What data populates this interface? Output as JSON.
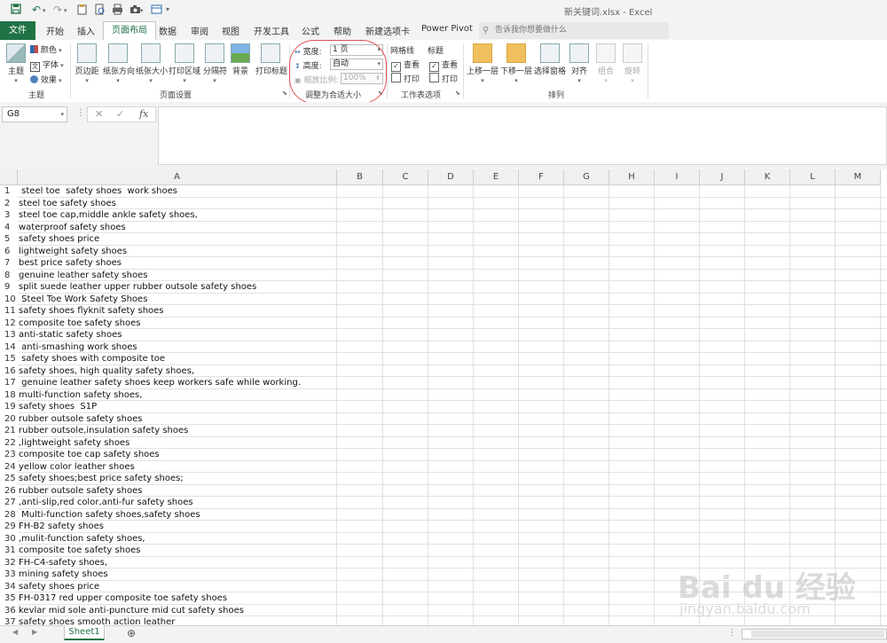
{
  "title_bar": {
    "document_title": "新关键词.xlsx  -  Excel",
    "quick_access": [
      "save-icon",
      "undo-icon",
      "redo-icon",
      "clipboard-icon",
      "print-icon",
      "camera-icon",
      "more-icon"
    ]
  },
  "tabs": {
    "file": "文件",
    "items": [
      "开始",
      "插入",
      "页面布局",
      "数据",
      "审阅",
      "视图",
      "开发工具",
      "公式",
      "帮助",
      "新建选项卡",
      "Power Pivot"
    ],
    "active": "页面布局",
    "tell_me_placeholder": "告诉我你想要做什么"
  },
  "ribbon": {
    "themes_group": {
      "label": "主题",
      "theme_button": "主题",
      "colors": "颜色",
      "fonts": "字体",
      "effects": "效果"
    },
    "page_setup_group": {
      "label": "页面设置",
      "buttons": [
        "页边距",
        "纸张方向",
        "纸张大小",
        "打印区域",
        "分隔符",
        "背景",
        "打印标题"
      ]
    },
    "scale_group": {
      "label": "调整为合适大小",
      "width_label": "宽度:",
      "width_value": "1 页",
      "height_label": "高度:",
      "height_value": "自动",
      "scale_label": "缩放比例:",
      "scale_value": "100%"
    },
    "sheet_options_group": {
      "label": "工作表选项",
      "gridlines_label": "网格线",
      "headings_label": "标题",
      "view": "查看",
      "print": "打印"
    },
    "arrange_group": {
      "label": "排列",
      "buttons": [
        "上移一层",
        "下移一层",
        "选择窗格",
        "对齐",
        "组合",
        "旋转"
      ]
    }
  },
  "formula_bar": {
    "name_box": "G8",
    "cancel": "✕",
    "enter": "✓",
    "fx": "fx",
    "value": ""
  },
  "grid": {
    "columns": [
      "A",
      "B",
      "C",
      "D",
      "E",
      "F",
      "G",
      "H",
      "I",
      "J",
      "K",
      "L",
      "M"
    ],
    "rows": [
      {
        "n": "1",
        "a": " steel toe  safety shoes  work shoes"
      },
      {
        "n": "2",
        "a": "steel toe safety shoes"
      },
      {
        "n": "3",
        "a": "steel toe cap,middle ankle safety shoes,"
      },
      {
        "n": "4",
        "a": "waterproof safety shoes"
      },
      {
        "n": "5",
        "a": "safety shoes price"
      },
      {
        "n": "6",
        "a": "lightweight safety shoes"
      },
      {
        "n": "7",
        "a": "best price safety shoes"
      },
      {
        "n": "8",
        "a": "genuine leather safety shoes"
      },
      {
        "n": "9",
        "a": "split suede leather upper rubber outsole safety shoes"
      },
      {
        "n": "10",
        "a": " Steel Toe Work Safety Shoes"
      },
      {
        "n": "11",
        "a": "safety shoes flyknit safety shoes"
      },
      {
        "n": "12",
        "a": "composite toe safety shoes"
      },
      {
        "n": "13",
        "a": "anti-static safety shoes"
      },
      {
        "n": "14",
        "a": " anti-smashing work shoes"
      },
      {
        "n": "15",
        "a": " safety shoes with composite toe"
      },
      {
        "n": "16",
        "a": "safety shoes, high quality safety shoes,"
      },
      {
        "n": "17",
        "a": " genuine leather safety shoes keep workers safe while working."
      },
      {
        "n": "18",
        "a": "multi-function safety shoes,"
      },
      {
        "n": "19",
        "a": "safety shoes  S1P"
      },
      {
        "n": "20",
        "a": "rubber outsole safety shoes"
      },
      {
        "n": "21",
        "a": "rubber outsole,insulation safety shoes"
      },
      {
        "n": "22",
        "a": ",lightweight safety shoes"
      },
      {
        "n": "23",
        "a": "composite toe cap safety shoes"
      },
      {
        "n": "24",
        "a": "yellow color leather shoes"
      },
      {
        "n": "25",
        "a": "safety shoes;best price safety shoes;"
      },
      {
        "n": "26",
        "a": "rubber outsole safety shoes"
      },
      {
        "n": "27",
        "a": ",anti-slip,red color,anti-fur safety shoes"
      },
      {
        "n": "28",
        "a": " Multi-function safety shoes,safety shoes"
      },
      {
        "n": "29",
        "a": "FH-B2 safety shoes"
      },
      {
        "n": "30",
        "a": ",mulit-function safety shoes,"
      },
      {
        "n": "31",
        "a": "composite toe safety shoes"
      },
      {
        "n": "32",
        "a": "FH-C4-safety shoes,"
      },
      {
        "n": "33",
        "a": "mining safety shoes"
      },
      {
        "n": "34",
        "a": "safety shoes price"
      },
      {
        "n": "35",
        "a": "FH-0317 red upper composite toe safety shoes"
      },
      {
        "n": "36",
        "a": "kevlar mid sole anti-puncture mid cut safety shoes"
      },
      {
        "n": "37",
        "a": "safety shoes smooth action leather"
      }
    ]
  },
  "sheets": {
    "active": "Sheet1",
    "add": "⊕"
  },
  "watermark": {
    "brand": "Bai du 经验",
    "url": "jingyan.baidu.com"
  },
  "colors": {
    "excel_green": "#217346",
    "annotation_red": "#e05050"
  }
}
